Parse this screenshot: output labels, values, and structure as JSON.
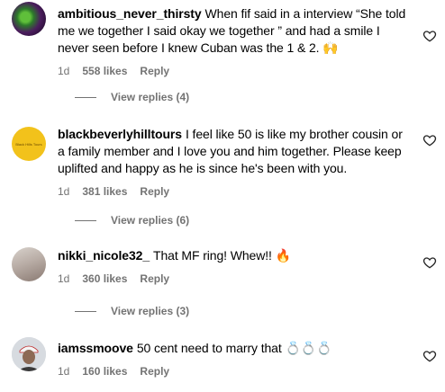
{
  "comments": [
    {
      "username": "ambitious_never_thirsty",
      "text": "When fif said in a interview “She told me we together I said okay we together ” and had a smile I never seen before I knew Cuban was the 1 & 2. 🙌",
      "age": "1d",
      "likes": "558 likes",
      "reply": "Reply",
      "view_replies": "View replies (4)"
    },
    {
      "username": "blackbeverlyhilltours",
      "avatar_text": "Black Hills Tours",
      "text": "I feel like 50 is like my brother cousin or a family member and I love you and him together. Please keep uplifted and happy as he is since he's been with you.",
      "age": "1d",
      "likes": "381 likes",
      "reply": "Reply",
      "view_replies": "View replies (6)"
    },
    {
      "username": "nikki_nicole32_",
      "text": "That MF ring! Whew!! 🔥",
      "age": "1d",
      "likes": "360 likes",
      "reply": "Reply",
      "view_replies": "View replies (3)"
    },
    {
      "username": "iamssmoove",
      "text": "50 cent need to marry that 💍💍💍",
      "age": "1d",
      "likes": "160 likes",
      "reply": "Reply"
    }
  ],
  "icons": {
    "like": "heart-outline-icon"
  },
  "colors": {
    "meta": "#737373",
    "text": "#000000"
  }
}
